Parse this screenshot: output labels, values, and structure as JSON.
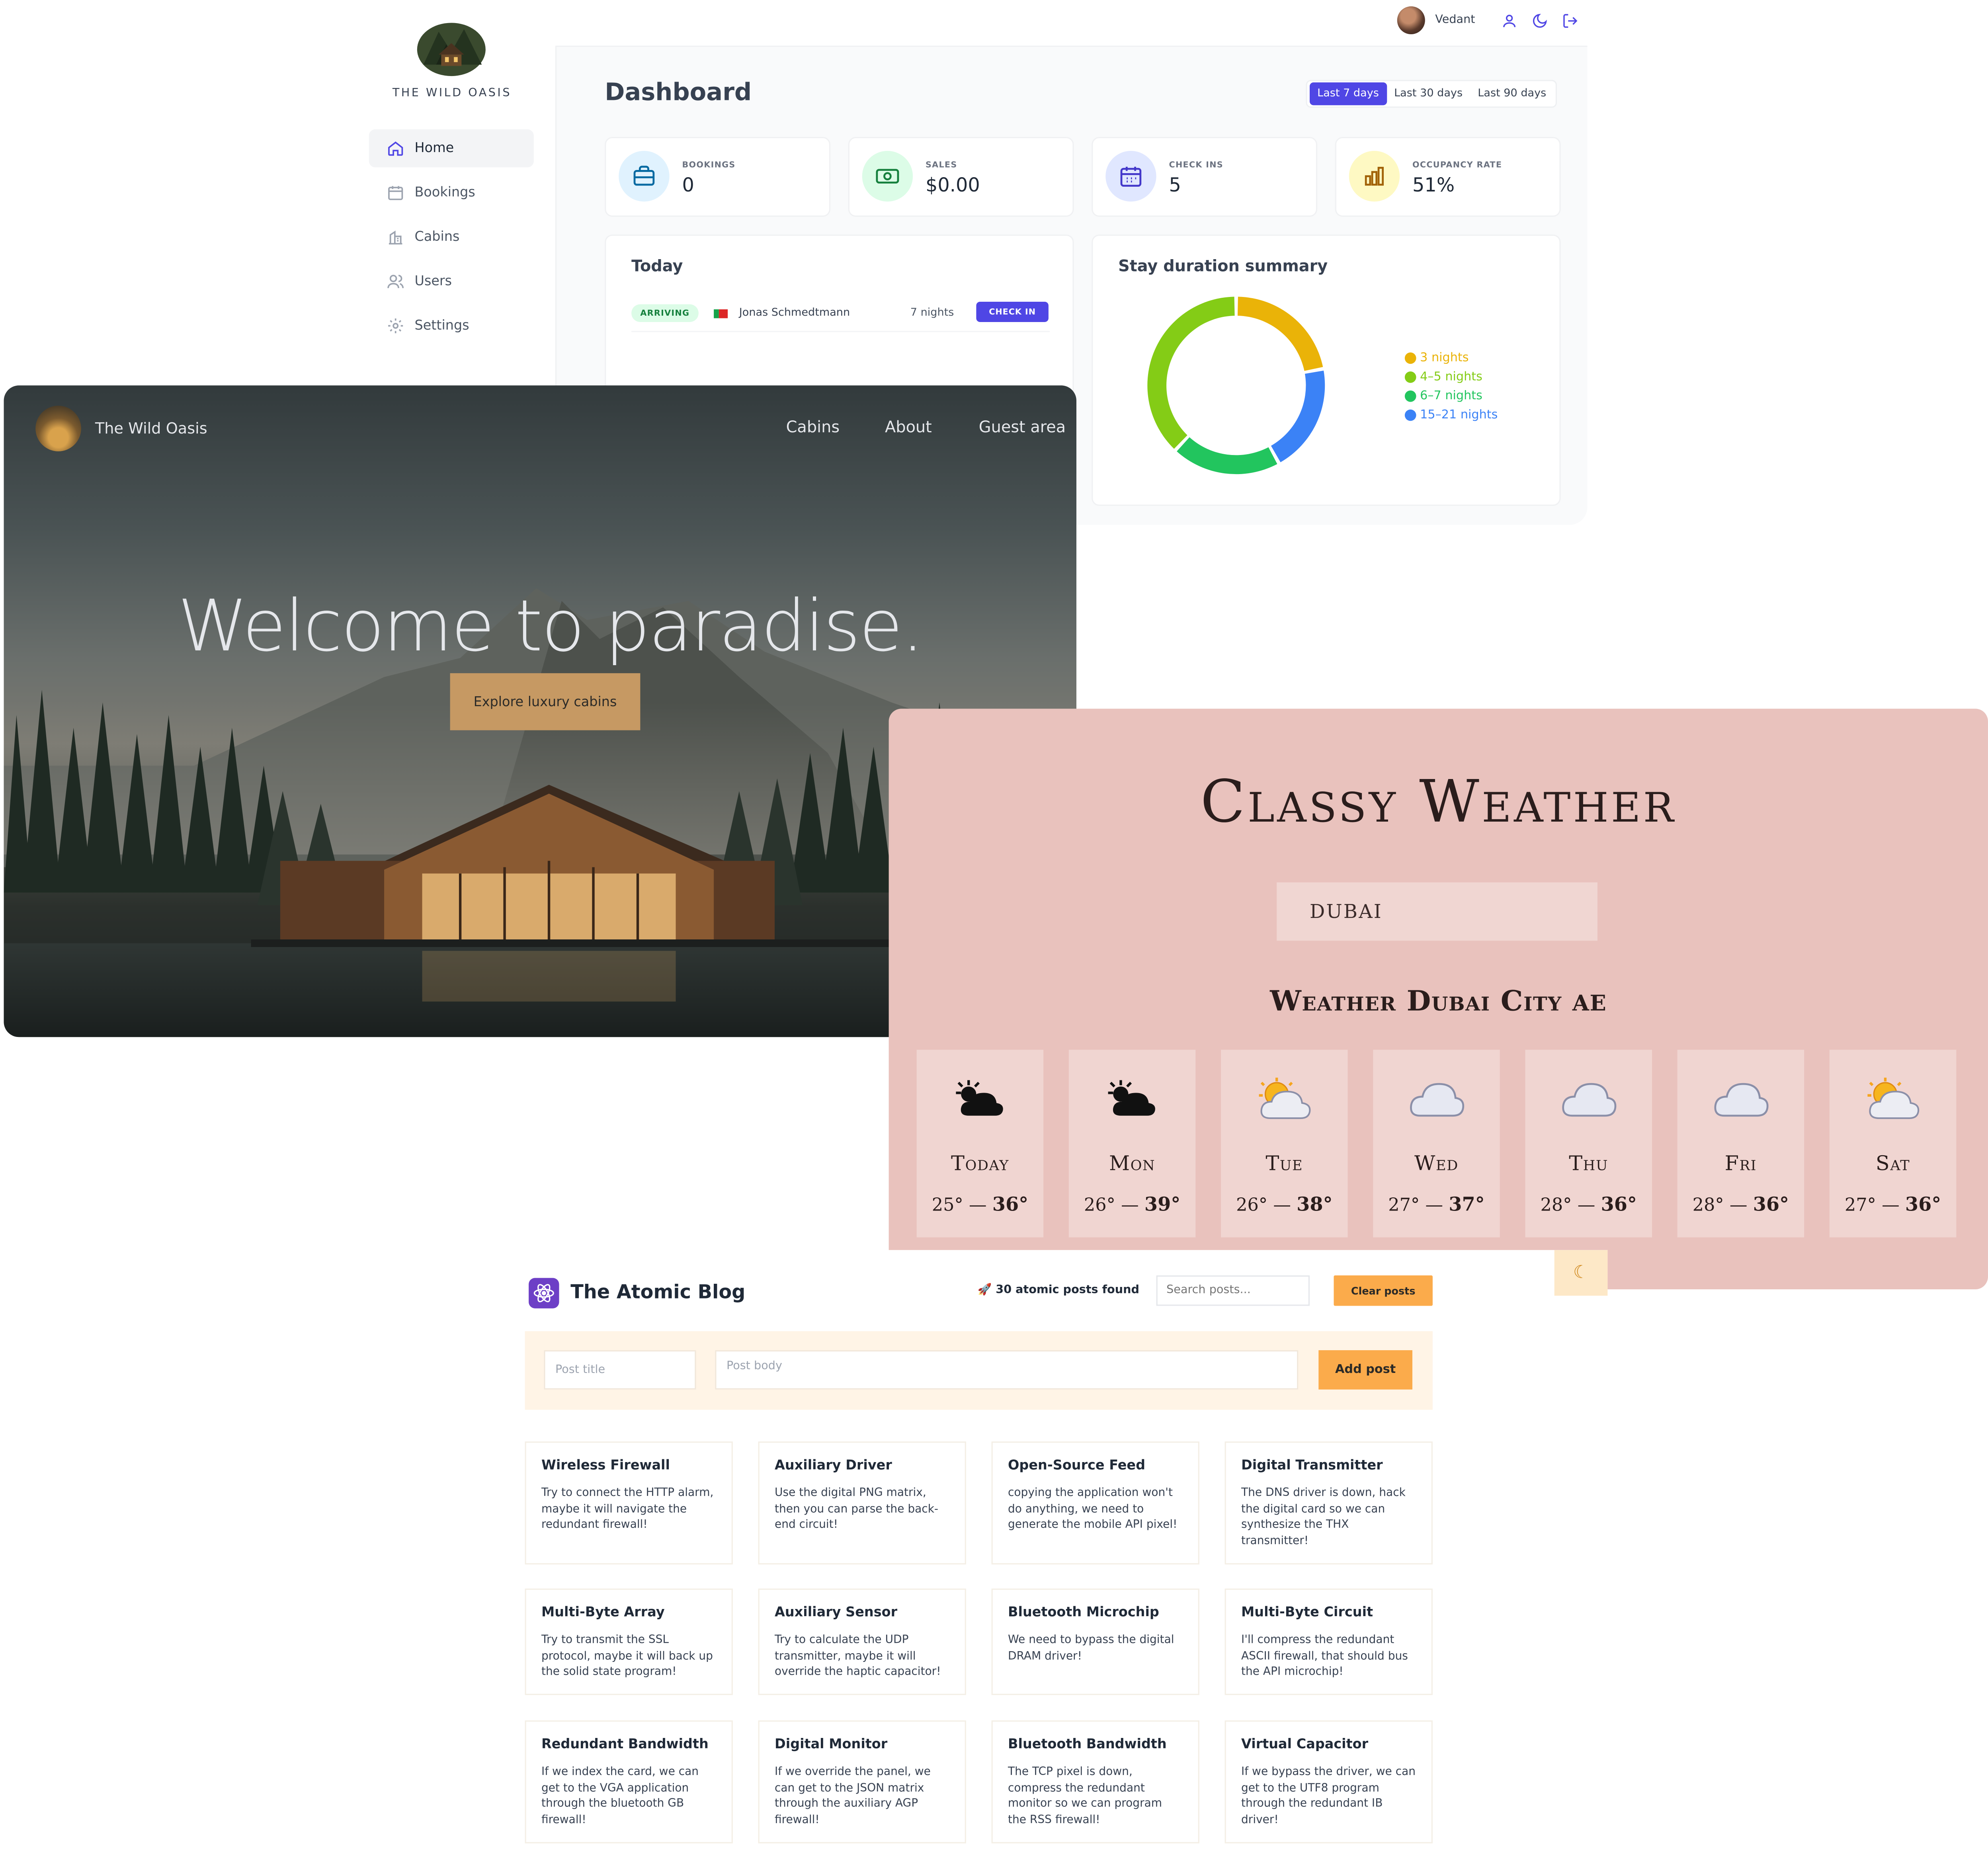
{
  "dashboard": {
    "brand": "THE WILD OASIS",
    "nav": [
      {
        "label": "Home",
        "icon": "home-icon",
        "active": true
      },
      {
        "label": "Bookings",
        "icon": "calendar-icon",
        "active": false
      },
      {
        "label": "Cabins",
        "icon": "building-icon",
        "active": false
      },
      {
        "label": "Users",
        "icon": "users-icon",
        "active": false
      },
      {
        "label": "Settings",
        "icon": "gear-icon",
        "active": false
      }
    ],
    "user": {
      "name": "Vedant"
    },
    "title": "Dashboard",
    "ranges": [
      {
        "label": "Last 7 days",
        "active": true
      },
      {
        "label": "Last 30 days",
        "active": false
      },
      {
        "label": "Last 90 days",
        "active": false
      }
    ],
    "stats": [
      {
        "label": "BOOKINGS",
        "value": "0",
        "icon": "briefcase-icon",
        "color": "#e0f2fe"
      },
      {
        "label": "SALES",
        "value": "$0.00",
        "icon": "banknote-icon",
        "color": "#dcfce7"
      },
      {
        "label": "CHECK INS",
        "value": "5",
        "icon": "calendar-days-icon",
        "color": "#e0e7ff"
      },
      {
        "label": "OCCUPANCY RATE",
        "value": "51%",
        "icon": "chart-bar-icon",
        "color": "#fef9c3"
      }
    ],
    "today": {
      "title": "Today",
      "activity": {
        "status": "ARRIVING",
        "guest": "Jonas Schmedtmann",
        "nights": "7 nights",
        "action": "CHECK IN"
      }
    },
    "stay_summary": {
      "title": "Stay duration summary",
      "legend": [
        {
          "label": "3 nights",
          "color": "#eab308"
        },
        {
          "label": "4–5 nights",
          "color": "#84cc16"
        },
        {
          "label": "6–7 nights",
          "color": "#22c55e"
        },
        {
          "label": "15–21 nights",
          "color": "#3b82f6"
        }
      ]
    }
  },
  "chart_data": {
    "type": "pie",
    "title": "Stay duration summary",
    "categories": [
      "3 nights",
      "4–5 nights",
      "6–7 nights",
      "15–21 nights"
    ],
    "values": [
      1,
      1,
      1,
      1
    ],
    "colors": [
      "#eab308",
      "#84cc16",
      "#22c55e",
      "#3b82f6"
    ],
    "ring_order": [
      "3 nights",
      "15–21 nights",
      "6–7 nights",
      "4–5 nights"
    ],
    "ring_values": [
      22,
      20,
      20,
      38
    ]
  },
  "oasis": {
    "brand": "The Wild Oasis",
    "nav": [
      "Cabins",
      "About",
      "Guest area"
    ],
    "hero": "Welcome to paradise.",
    "cta": "Explore luxury cabins"
  },
  "weather": {
    "title": "Classy Weather",
    "location": "DUBAI",
    "subtitle": "Weather Dubai City",
    "country": "AE",
    "days": [
      {
        "name": "Today",
        "min": "25°",
        "max": "36°",
        "icon": "sun-behind-cloud-icon",
        "style": "dark"
      },
      {
        "name": "Mon",
        "min": "26°",
        "max": "39°",
        "icon": "sun-behind-cloud-icon",
        "style": "dark"
      },
      {
        "name": "Tue",
        "min": "26°",
        "max": "38°",
        "icon": "sun-behind-cloud-icon",
        "style": "color"
      },
      {
        "name": "Wed",
        "min": "27°",
        "max": "37°",
        "icon": "cloud-icon",
        "style": "color"
      },
      {
        "name": "Thu",
        "min": "28°",
        "max": "36°",
        "icon": "cloud-icon",
        "style": "color"
      },
      {
        "name": "Fri",
        "min": "28°",
        "max": "36°",
        "icon": "cloud-icon",
        "style": "color"
      },
      {
        "name": "Sat",
        "min": "27°",
        "max": "36°",
        "icon": "sun-behind-cloud-icon",
        "style": "color"
      }
    ]
  },
  "blog": {
    "title": "The Atomic Blog",
    "count": "30 atomic posts found",
    "search_placeholder": "Search posts...",
    "clear_label": "Clear posts",
    "title_placeholder": "Post title",
    "body_placeholder": "Post body",
    "add_label": "Add post",
    "posts": [
      {
        "title": "Wireless Firewall",
        "body": "Try to connect the HTTP alarm, maybe it will navigate the redundant firewall!"
      },
      {
        "title": "Auxiliary Driver",
        "body": "Use the digital PNG matrix, then you can parse the back-end circuit!"
      },
      {
        "title": "Open-Source Feed",
        "body": "copying the application won't do anything, we need to generate the mobile API pixel!"
      },
      {
        "title": "Digital Transmitter",
        "body": "The DNS driver is down, hack the digital card so we can synthesize the THX transmitter!"
      },
      {
        "title": "Multi-Byte Array",
        "body": "Try to transmit the SSL protocol, maybe it will back up the solid state program!"
      },
      {
        "title": "Auxiliary Sensor",
        "body": "Try to calculate the UDP transmitter, maybe it will override the haptic capacitor!"
      },
      {
        "title": "Bluetooth Microchip",
        "body": "We need to bypass the digital DRAM driver!"
      },
      {
        "title": "Multi-Byte Circuit",
        "body": "I'll compress the redundant ASCII firewall, that should bus the API microchip!"
      },
      {
        "title": "Redundant Bandwidth",
        "body": "If we index the card, we can get to the VGA application through the bluetooth GB firewall!"
      },
      {
        "title": "Digital Monitor",
        "body": "If we override the panel, we can get to the JSON matrix through the auxiliary AGP firewall!"
      },
      {
        "title": "Bluetooth Bandwidth",
        "body": "The TCP pixel is down, compress the redundant monitor so we can program the RSS firewall!"
      },
      {
        "title": "Virtual Capacitor",
        "body": "If we bypass the driver, we can get to the UTF8 program through the redundant IB driver!"
      }
    ]
  }
}
